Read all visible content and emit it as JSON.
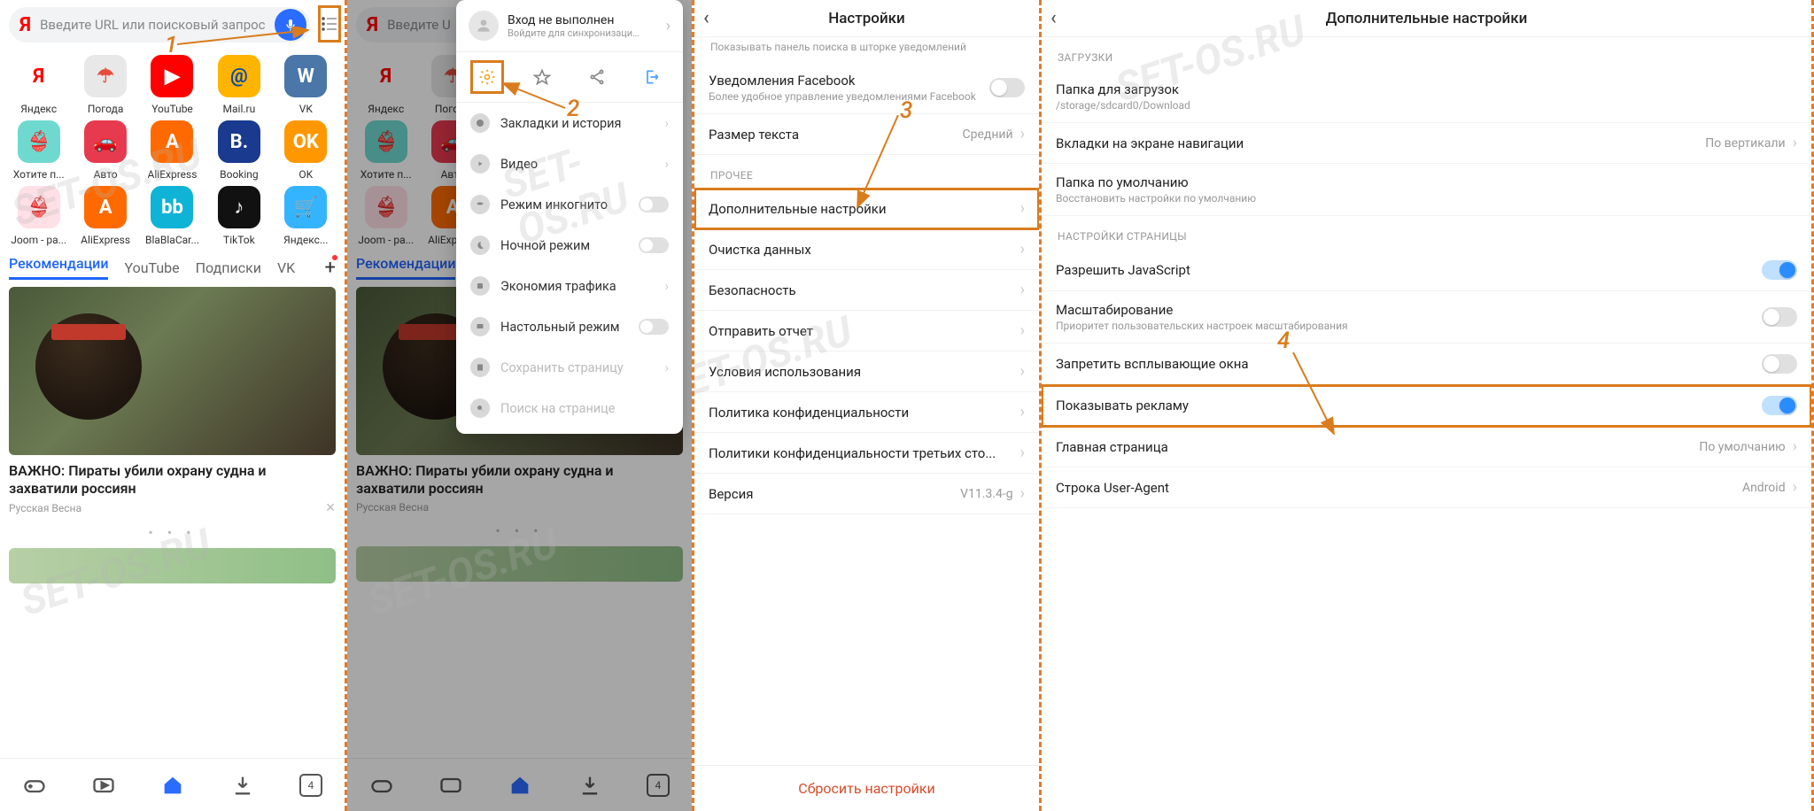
{
  "watermark": "SET-OS.RU",
  "annotations": {
    "n1": "1",
    "n2": "2",
    "n3": "3",
    "n4": "4"
  },
  "search": {
    "placeholder": "Введите URL или поисковый запрос"
  },
  "apps_row1": [
    {
      "label": "Яндекс",
      "bg": "#ffffff",
      "fg": "#ff0000",
      "glyph": "Я"
    },
    {
      "label": "Погода",
      "bg": "#e8e8e8",
      "fg": "#e84c3d",
      "glyph": "☂"
    },
    {
      "label": "YouTube",
      "bg": "#ff0000",
      "fg": "#ffffff",
      "glyph": "▶"
    },
    {
      "label": "Mail.ru",
      "bg": "#ffb400",
      "fg": "#0a4aa8",
      "glyph": "@"
    },
    {
      "label": "VK",
      "bg": "#4a76a8",
      "fg": "#ffffff",
      "glyph": "W"
    }
  ],
  "apps_row2": [
    {
      "label": "Хотите п...",
      "bg": "#6fd9cf",
      "fg": "#ffffff",
      "glyph": "👙"
    },
    {
      "label": "Авто",
      "bg": "#e83a4f",
      "fg": "#ffffff",
      "glyph": "🚗"
    },
    {
      "label": "AliExpress",
      "bg": "#ff6a00",
      "fg": "#ffffff",
      "glyph": "A"
    },
    {
      "label": "Booking",
      "bg": "#1a3a8f",
      "fg": "#ffffff",
      "glyph": "B."
    },
    {
      "label": "OK",
      "bg": "#ff9800",
      "fg": "#ffffff",
      "glyph": "OK"
    }
  ],
  "apps_row3": [
    {
      "label": "Joom - pa...",
      "bg": "#ffe0e6",
      "fg": "#d8486a",
      "glyph": "👙"
    },
    {
      "label": "AliExpress",
      "bg": "#ff6a00",
      "fg": "#ffffff",
      "glyph": "A"
    },
    {
      "label": "BlaBlaCar...",
      "bg": "#0fb3d6",
      "fg": "#ffffff",
      "glyph": "bb"
    },
    {
      "label": "TikTok",
      "bg": "#111111",
      "fg": "#ffffff",
      "glyph": "♪"
    },
    {
      "label": "Яндекс...",
      "bg": "#34b3ff",
      "fg": "#ffffff",
      "glyph": "🛒"
    }
  ],
  "tabs": {
    "rec": "Рекомендации",
    "yt": "YouTube",
    "subs": "Подписки",
    "vk": "VK"
  },
  "news": {
    "title": "ВАЖНО: Пираты убили охрану судна и захватили россиян",
    "source": "Русская Весна"
  },
  "bottombar": {
    "tab_count": "4"
  },
  "menu": {
    "login_title": "Вход не выполнен",
    "login_sub": "Войдите для синхронизации ...",
    "bookmarks": "Закладки и история",
    "video": "Видео",
    "incognito": "Режим инкогнито",
    "night": "Ночной режим",
    "economy": "Экономия трафика",
    "desktop": "Настольный режим",
    "save": "Сохранить страницу",
    "find": "Поиск на странице"
  },
  "settings": {
    "title": "Настройки",
    "search_hint": "Показывать панель поиска в шторке уведомлений",
    "fb_title": "Уведомления Facebook",
    "fb_sub": "Более удобное управление уведомлениями Facebook",
    "text_size": "Размер текста",
    "text_size_val": "Средний",
    "section_other": "ПРОЧЕЕ",
    "advanced": "Дополнительные настройки",
    "clear": "Очистка данных",
    "security": "Безопасность",
    "report": "Отправить отчет",
    "terms": "Условия использования",
    "privacy": "Политика конфиденциальности",
    "third": "Политики конфиденциальности третьих сто...",
    "version_label": "Версия",
    "version_val": "V11.3.4-g",
    "reset": "Сбросить настройки"
  },
  "adv": {
    "title": "Дополнительные настройки",
    "section_dl": "ЗАГРУЗКИ",
    "dl_folder": "Папка для загрузок",
    "dl_folder_sub": "/storage/sdcard0/Download",
    "nav_tabs": "Вкладки на экране навигации",
    "nav_tabs_val": "По вертикали",
    "default_folder": "Папка по умолчанию",
    "default_folder_sub": "Восстановить настройки по умолчанию",
    "section_page": "НАСТРОЙКИ СТРАНИЦЫ",
    "js": "Разрешить JavaScript",
    "scale": "Масштабирование",
    "scale_sub": "Приоритет пользовательских настроек масштабирования",
    "popup": "Запретить всплывающие окна",
    "ads": "Показывать рекламу",
    "home": "Главная страница",
    "home_val": "По умолчанию",
    "ua": "Строка User-Agent",
    "ua_val": "Android"
  }
}
